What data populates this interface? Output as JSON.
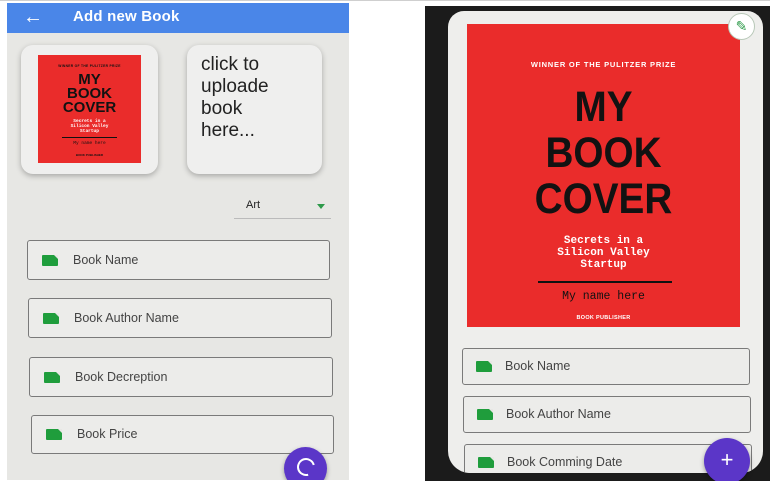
{
  "left_screen": {
    "app_bar": {
      "back_icon": "arrow-left-icon",
      "title": "Add new Book"
    },
    "cover_preview": {
      "winner_text": "WINNER OF THE PULITZER PRIZE",
      "title": "MY\nBOOK\nCOVER",
      "subtitle": "Secrets in a\nSilicon Valley\nStartup",
      "author": "My name here",
      "publisher": "BOOK PUBLISHER"
    },
    "upload_prompt": "click to\nuploade\nbook\nhere...",
    "category_dropdown": {
      "selected": "Art"
    },
    "fields": [
      {
        "icon": "label-tag-icon",
        "placeholder": "Book Name"
      },
      {
        "icon": "label-tag-icon",
        "placeholder": "Book Author Name"
      },
      {
        "icon": "label-tag-icon",
        "placeholder": "Book Decreption"
      },
      {
        "icon": "label-tag-icon",
        "placeholder": "Book Price"
      }
    ],
    "fab_icon": "upload-icon"
  },
  "right_screen": {
    "edit_icon": "pencil-icon",
    "cover": {
      "winner_text": "WINNER OF THE PULITZER PRIZE",
      "title": "MY\nBOOK\nCOVER",
      "subtitle": "Secrets in a\nSilicon Valley\nStartup",
      "author": "My name here",
      "publisher": "BOOK PUBLISHER"
    },
    "fields": [
      {
        "icon": "label-tag-icon",
        "placeholder": "Book Name"
      },
      {
        "icon": "label-tag-icon",
        "placeholder": "Book Author Name"
      },
      {
        "icon": "label-tag-icon",
        "placeholder": "Book Comming Date"
      }
    ],
    "fab_icon": "plus-icon"
  },
  "colors": {
    "app_bar": "#4a86e8",
    "cover_red": "#ea2c2b",
    "field_icon_green": "#1f9d3c",
    "fab_purple": "#5b36c8"
  }
}
